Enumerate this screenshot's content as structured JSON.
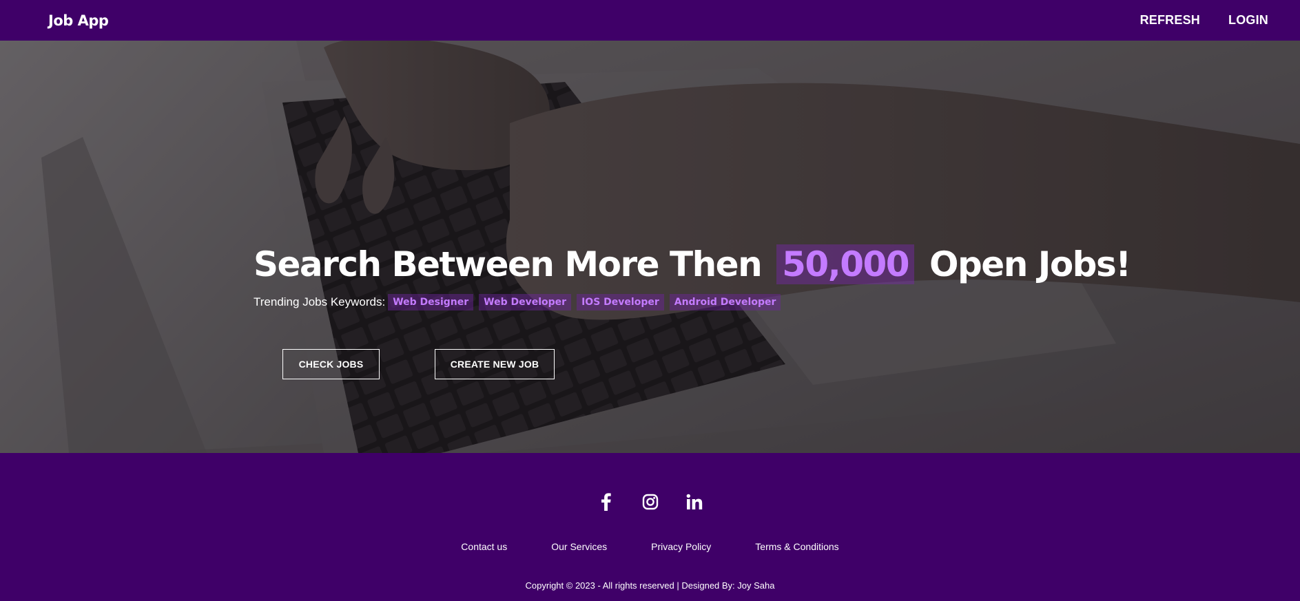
{
  "nav": {
    "brand": "Job App",
    "refresh_label": "REFRESH",
    "login_label": "LOGIN"
  },
  "hero": {
    "headline_prefix": "Search Between More Then",
    "headline_highlight": "50,000",
    "headline_suffix": "Open Jobs!",
    "trending_label": "Trending Jobs Keywords:",
    "keywords": [
      "Web Designer",
      "Web Developer",
      "IOS Developer",
      "Android Developer"
    ],
    "check_jobs_label": "CHECK JOBS",
    "create_job_label": "CREATE NEW JOB"
  },
  "footer": {
    "social": [
      "facebook-icon",
      "instagram-icon",
      "linkedin-icon"
    ],
    "links": [
      "Contact us",
      "Our Services",
      "Privacy Policy",
      "Terms & Conditions"
    ],
    "copyright": "Copyright © 2023 - All rights reserved | Designed By: Joy Saha"
  },
  "colors": {
    "brand_purple": "#3f0068",
    "accent_purple": "#c47bff"
  }
}
